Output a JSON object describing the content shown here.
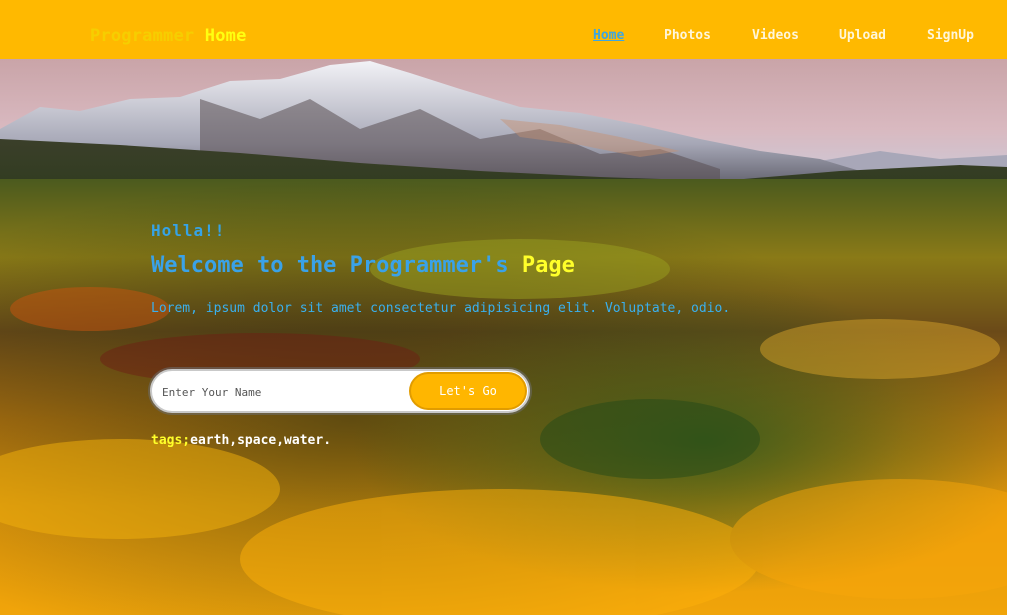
{
  "header": {
    "brand_part1": "Programmer",
    "brand_part2": "Home",
    "nav": [
      "Home",
      "Photos",
      "Videos",
      "Upload",
      "SignUp"
    ],
    "active_nav": "Home"
  },
  "hero": {
    "greeting": "Holla!!",
    "headline_main": "Welcome to the Programmer's",
    "headline_highlight": "Page",
    "subtext": "Lorem, ipsum dolor sit amet consectetur adipisicing elit. Voluptate, odio."
  },
  "search": {
    "placeholder": "Enter Your Name",
    "value": "",
    "button_label": "Let's Go"
  },
  "tags": {
    "label": "tags;",
    "values": "earth,space,water."
  },
  "colors": {
    "nav_background": "#ffb900",
    "accent_blue": "#3aa2e8",
    "accent_yellow": "#ffff2a",
    "button_orange": "#ffb600"
  }
}
